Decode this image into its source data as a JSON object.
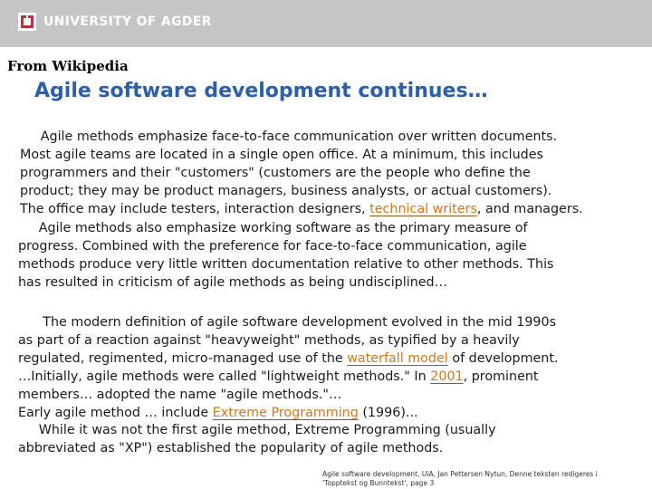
{
  "header": {
    "logo_text": "UNIVERSITY OF AGDER"
  },
  "source": "From Wikipedia",
  "title": "Agile software development continues…",
  "p1": {
    "l1": "     Agile methods emphasize face-to-face communication over written documents.",
    "l2": "Most agile teams are located in a single open office. At a minimum, this includes",
    "l3": "programmers and their \"customers\" (customers are the people who define the",
    "l4": "product; they may be product managers, business analysts, or actual customers).",
    "l5_pre": "The office may include testers, interaction designers, ",
    "l5_link": "technical writers",
    "l5_post": ", and managers."
  },
  "p2": {
    "l1": "     Agile methods also emphasize working software as the primary measure of",
    "l2": "progress. Combined with the preference for face-to-face communication, agile",
    "l3": "methods produce very little written documentation relative to other methods. This",
    "l4": "has resulted in criticism of agile methods as being undisciplined…"
  },
  "p3": {
    "l1": "      The modern definition of agile software development evolved in the mid 1990s",
    "l2": "as part of a reaction against \"heavyweight\" methods, as typified by a heavily",
    "l3_pre": "regulated, regimented, micro-managed use of the ",
    "l3_link": "waterfall model",
    "l3_post": " of development.",
    "l4_pre": "…Initially, agile methods were called \"lightweight methods.\" In ",
    "l4_link": "2001",
    "l4_post": ", prominent",
    "l5": "members… adopted the name \"agile methods.\"…",
    "l6_pre": "Early agile method … include ",
    "l6_link": "Extreme Programming",
    "l6_post": " (1996)..."
  },
  "p4": {
    "l1": "     While it was not the first agile method, Extreme Programming (usually",
    "l2": "abbreviated as \"XP\") established the popularity of agile methods."
  },
  "footer": {
    "l1": "Agile software development, UiA, Jan Pettersen Nytun, Denne teksten redigeres i",
    "l2": "'Topptekst og Bunntekst', page 3"
  }
}
